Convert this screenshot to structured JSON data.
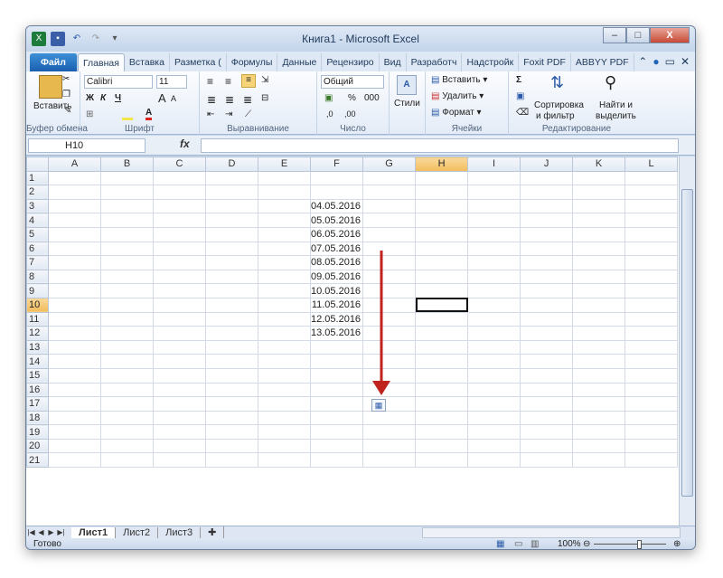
{
  "window": {
    "title": "Книга1  -  Microsoft Excel",
    "minimize": "–",
    "maximize": "□",
    "close": "X"
  },
  "tabs": [
    {
      "label": "Файл",
      "kind": "file"
    },
    {
      "label": "Главная",
      "kind": "active"
    },
    {
      "label": "Вставка",
      "kind": ""
    },
    {
      "label": "Разметка (",
      "kind": ""
    },
    {
      "label": "Формулы",
      "kind": ""
    },
    {
      "label": "Данные",
      "kind": ""
    },
    {
      "label": "Рецензиро",
      "kind": ""
    },
    {
      "label": "Вид",
      "kind": ""
    },
    {
      "label": "Разработч",
      "kind": ""
    },
    {
      "label": "Надстройк",
      "kind": ""
    },
    {
      "label": "Foxit PDF",
      "kind": ""
    },
    {
      "label": "ABBYY PDF",
      "kind": ""
    }
  ],
  "ribbon": {
    "clipboard": {
      "paste": "Вставить",
      "label": "Буфер обмена"
    },
    "font": {
      "name": "Calibri",
      "size": "11",
      "bold": "Ж",
      "italic": "К",
      "underline": "Ч",
      "grow": "A",
      "shrink": "A",
      "label": "Шрифт"
    },
    "alignment": {
      "label": "Выравнивание"
    },
    "number": {
      "format": "Общий",
      "percent": "%",
      "thousands": "000",
      "inc": ",0",
      "dec": ",00",
      "label": "Число"
    },
    "styles": {
      "label": "Стили"
    },
    "cells": {
      "insert": "Вставить",
      "delete": "Удалить",
      "format": "Формат",
      "label": "Ячейки"
    },
    "editing": {
      "sigma": "Σ",
      "sort": "Сортировка",
      "sort2": "и фильтр",
      "find": "Найти и",
      "find2": "выделить",
      "label": "Редактирование"
    }
  },
  "formula_bar": {
    "name_box": "H10",
    "fx": "fx",
    "formula": ""
  },
  "columns": [
    "A",
    "B",
    "C",
    "D",
    "E",
    "F",
    "G",
    "H",
    "I",
    "J",
    "K",
    "L"
  ],
  "selected_column": "H",
  "rows": [
    "1",
    "2",
    "3",
    "4",
    "5",
    "6",
    "7",
    "8",
    "9",
    "10",
    "11",
    "12",
    "13",
    "14",
    "15",
    "16",
    "17",
    "18",
    "19",
    "20",
    "21"
  ],
  "selected_row": "10",
  "dates": [
    "04.05.2016",
    "05.05.2016",
    "06.05.2016",
    "07.05.2016",
    "08.05.2016",
    "09.05.2016",
    "10.05.2016",
    "11.05.2016",
    "12.05.2016",
    "13.05.2016"
  ],
  "sheets": [
    "Лист1",
    "Лист2",
    "Лист3"
  ],
  "status": {
    "ready": "Готово",
    "zoom": "100%"
  },
  "colors": {
    "arrow": "#c0231d",
    "selection": "#111111"
  }
}
